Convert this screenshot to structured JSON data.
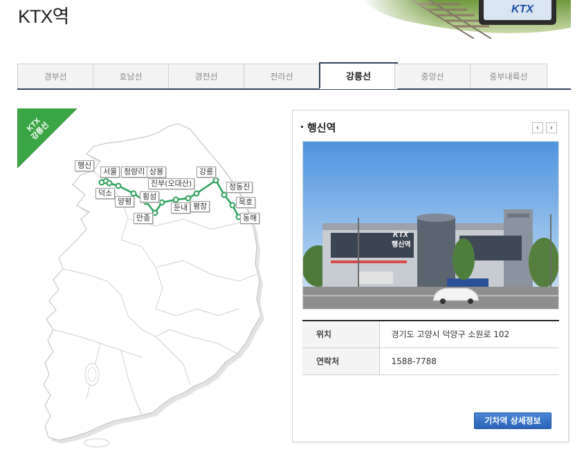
{
  "page": {
    "title": "KTX역"
  },
  "banner": {
    "logo_text": "KTX"
  },
  "tabs": [
    {
      "label": "경부선",
      "active": false
    },
    {
      "label": "호남선",
      "active": false
    },
    {
      "label": "경전선",
      "active": false
    },
    {
      "label": "전라선",
      "active": false
    },
    {
      "label": "강릉선",
      "active": true
    },
    {
      "label": "중앙선",
      "active": false
    },
    {
      "label": "중부내륙선",
      "active": false
    }
  ],
  "map": {
    "ribbon_line1": "KTX",
    "ribbon_line2": "강릉선",
    "line_color": "#2aa05a",
    "ribbon_color": "#3aa544",
    "stations": [
      {
        "name": "행신"
      },
      {
        "name": "서울"
      },
      {
        "name": "청량리"
      },
      {
        "name": "상봉"
      },
      {
        "name": "덕소"
      },
      {
        "name": "양평"
      },
      {
        "name": "진부(오대산)"
      },
      {
        "name": "횡성"
      },
      {
        "name": "만종"
      },
      {
        "name": "둔내"
      },
      {
        "name": "평창"
      },
      {
        "name": "강릉"
      },
      {
        "name": "정동진"
      },
      {
        "name": "묵호"
      },
      {
        "name": "동해"
      }
    ]
  },
  "panel": {
    "station_name": "행신역",
    "prev_label": "‹",
    "next_label": "›",
    "photo_sign": "행신역",
    "photo_logo": "KTX",
    "rows": [
      {
        "label": "위치",
        "value": "경기도 고양시 덕양구 소원로 102"
      },
      {
        "label": "연락처",
        "value": "1588-7788"
      }
    ],
    "detail_button": "기차역 상세정보"
  }
}
